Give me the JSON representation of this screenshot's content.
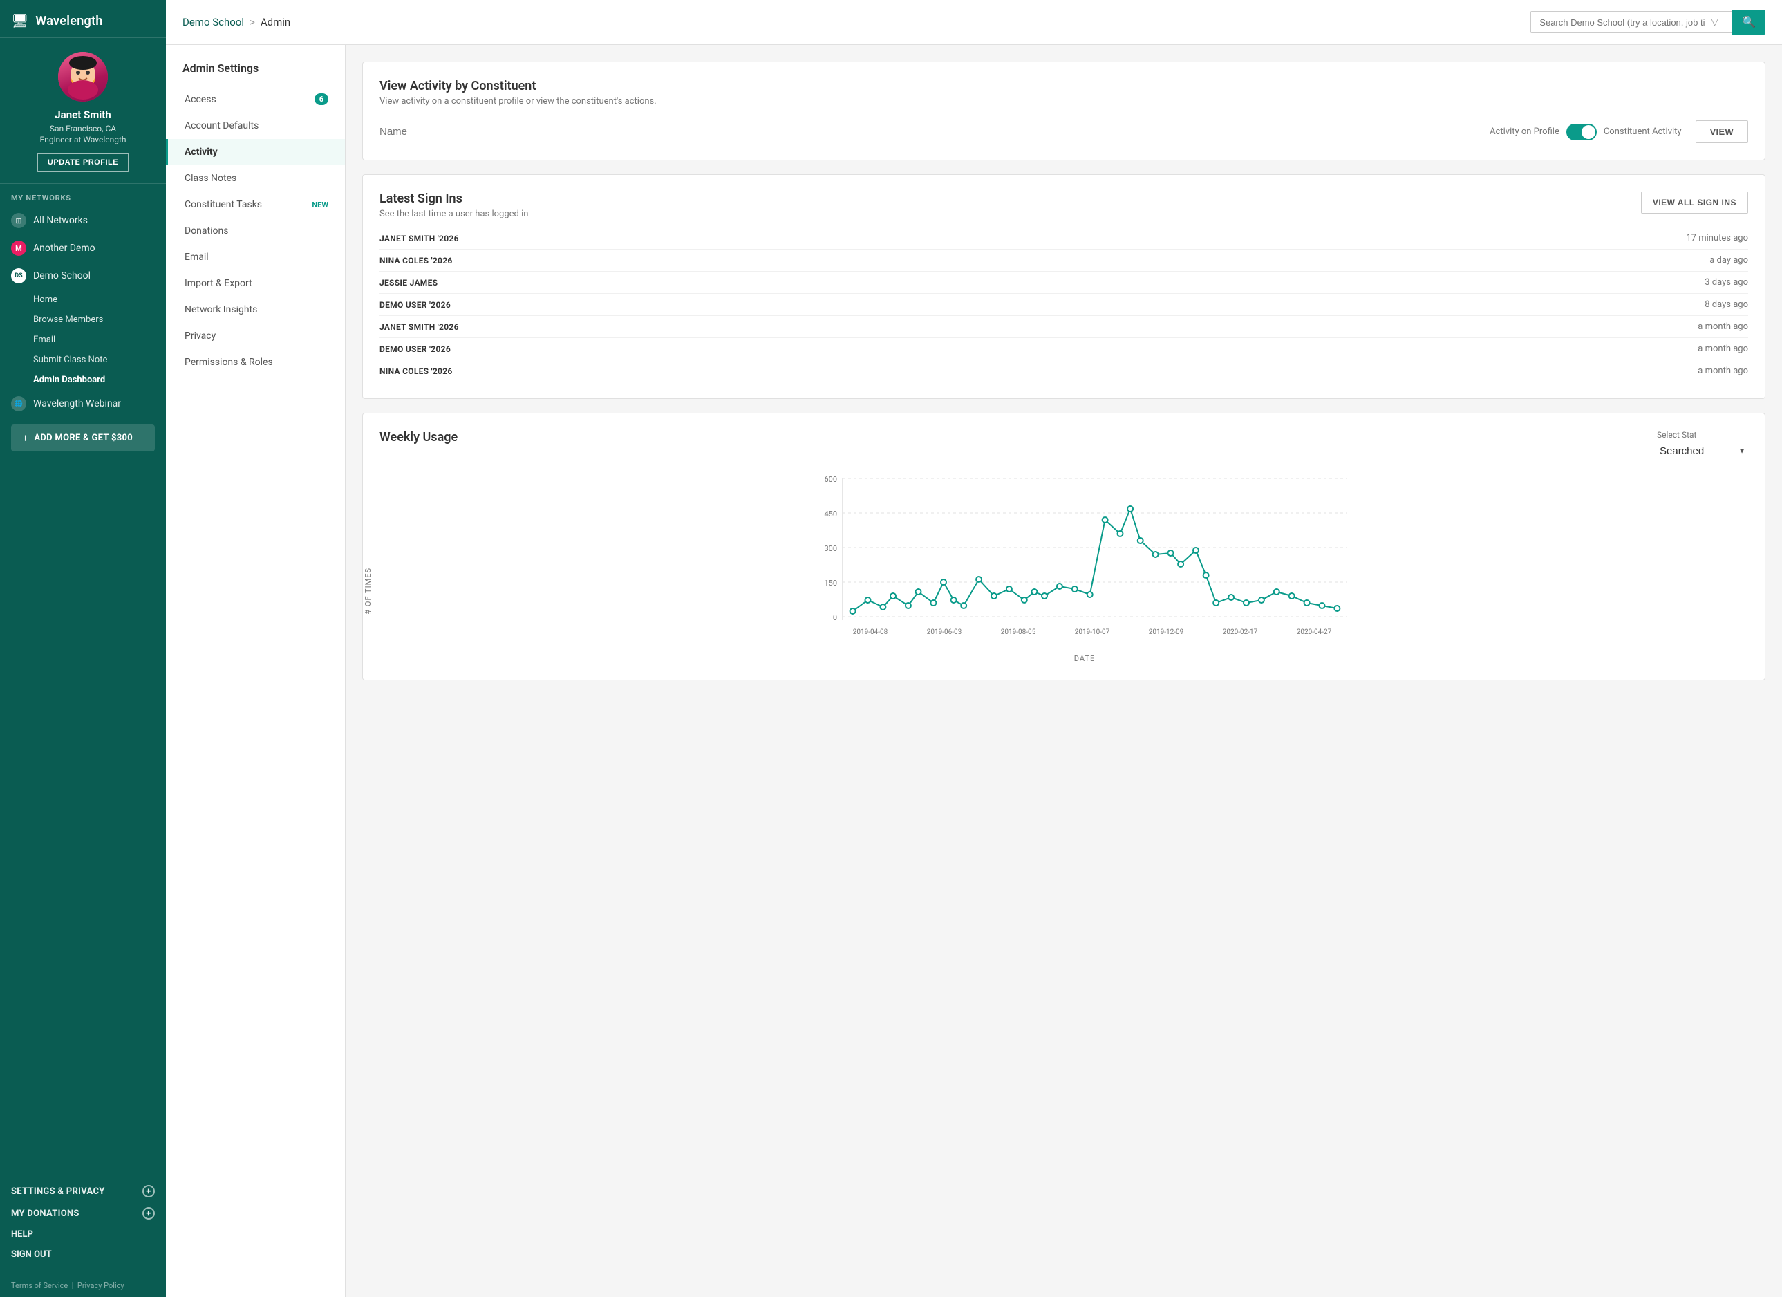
{
  "sidebar": {
    "logo": "🖥 Wavelength",
    "logo_text": "Wavelength",
    "user": {
      "name": "Janet Smith",
      "location": "San Francisco, CA",
      "title": "Engineer at Wavelength",
      "update_btn": "UPDATE PROFILE"
    },
    "my_networks_label": "MY NETWORKS",
    "networks": [
      {
        "id": "all",
        "label": "All Networks",
        "icon": "grid"
      },
      {
        "id": "another-demo",
        "label": "Another Demo",
        "icon": "M"
      },
      {
        "id": "demo-school",
        "label": "Demo School",
        "icon": "DS",
        "active": true
      }
    ],
    "demo_school_subnav": [
      {
        "id": "home",
        "label": "Home",
        "active": false
      },
      {
        "id": "browse-members",
        "label": "Browse Members",
        "active": false
      },
      {
        "id": "email",
        "label": "Email",
        "active": false
      },
      {
        "id": "submit-class-note",
        "label": "Submit Class Note",
        "active": false
      },
      {
        "id": "admin-dashboard",
        "label": "Admin Dashboard",
        "active": true
      }
    ],
    "wavelength_webinar": {
      "label": "Wavelength Webinar",
      "icon": "WW"
    },
    "add_more": "ADD MORE & GET $300",
    "settings_privacy": "SETTINGS & PRIVACY",
    "my_donations": "MY DONATIONS",
    "help": "HELP",
    "sign_out": "SIGN OUT",
    "footer": {
      "terms": "Terms of Service",
      "privacy": "Privacy Policy"
    }
  },
  "topbar": {
    "breadcrumb": {
      "school": "Demo School",
      "separator": ">",
      "page": "Admin"
    },
    "search_placeholder": "Search Demo School (try a location, job title, or c..."
  },
  "admin_settings": {
    "title": "Admin Settings",
    "items": [
      {
        "id": "access",
        "label": "Access",
        "badge": "6",
        "badge_type": "count"
      },
      {
        "id": "account-defaults",
        "label": "Account Defaults",
        "badge": null
      },
      {
        "id": "activity",
        "label": "Activity",
        "badge": null,
        "active": true
      },
      {
        "id": "class-notes",
        "label": "Class Notes",
        "badge": null
      },
      {
        "id": "constituent-tasks",
        "label": "Constituent Tasks",
        "badge": "NEW",
        "badge_type": "new"
      },
      {
        "id": "donations",
        "label": "Donations",
        "badge": null
      },
      {
        "id": "email",
        "label": "Email",
        "badge": null
      },
      {
        "id": "import-export",
        "label": "Import & Export",
        "badge": null
      },
      {
        "id": "network-insights",
        "label": "Network Insights",
        "badge": null
      },
      {
        "id": "privacy",
        "label": "Privacy",
        "badge": null
      },
      {
        "id": "permissions-roles",
        "label": "Permissions & Roles",
        "badge": null
      }
    ]
  },
  "view_activity": {
    "title": "View Activity by Constituent",
    "subtitle": "View activity on a constituent profile or view the constituent's actions.",
    "name_placeholder": "Name",
    "toggle_left": "Activity on Profile",
    "toggle_right": "Constituent Activity",
    "view_btn": "VIEW"
  },
  "latest_sign_ins": {
    "title": "Latest Sign Ins",
    "subtitle": "See the last time a user has logged in",
    "view_all_btn": "VIEW ALL SIGN INS",
    "entries": [
      {
        "name": "JANET SMITH '2026",
        "time": "17 minutes ago"
      },
      {
        "name": "NINA COLES '2026",
        "time": "a day ago"
      },
      {
        "name": "JESSIE JAMES",
        "time": "3 days ago"
      },
      {
        "name": "DEMO USER '2026",
        "time": "8 days ago"
      },
      {
        "name": "JANET SMITH '2026",
        "time": "a month ago"
      },
      {
        "name": "DEMO USER '2026",
        "time": "a month ago"
      },
      {
        "name": "NINA COLES '2026",
        "time": "a month ago"
      }
    ]
  },
  "weekly_usage": {
    "title": "Weekly Usage",
    "select_stat_label": "Select Stat",
    "selected_stat": "Searched",
    "y_axis_label": "# OF TIMES",
    "x_axis_label": "DATE",
    "x_labels": [
      "2019-04-08",
      "2019-06-03",
      "2019-08-05",
      "2019-10-07",
      "2019-12-09",
      "2020-02-17",
      "2020-04-27"
    ],
    "y_labels": [
      "0",
      "150",
      "300",
      "450",
      "600"
    ],
    "chart_color": "#0a9b8a",
    "data_points": [
      {
        "x": 0.02,
        "y": 0.04
      },
      {
        "x": 0.05,
        "y": 0.12
      },
      {
        "x": 0.08,
        "y": 0.07
      },
      {
        "x": 0.1,
        "y": 0.15
      },
      {
        "x": 0.13,
        "y": 0.08
      },
      {
        "x": 0.15,
        "y": 0.18
      },
      {
        "x": 0.18,
        "y": 0.1
      },
      {
        "x": 0.2,
        "y": 0.25
      },
      {
        "x": 0.22,
        "y": 0.12
      },
      {
        "x": 0.24,
        "y": 0.08
      },
      {
        "x": 0.27,
        "y": 0.27
      },
      {
        "x": 0.3,
        "y": 0.15
      },
      {
        "x": 0.33,
        "y": 0.2
      },
      {
        "x": 0.36,
        "y": 0.12
      },
      {
        "x": 0.38,
        "y": 0.18
      },
      {
        "x": 0.4,
        "y": 0.15
      },
      {
        "x": 0.43,
        "y": 0.22
      },
      {
        "x": 0.46,
        "y": 0.2
      },
      {
        "x": 0.49,
        "y": 0.16
      },
      {
        "x": 0.52,
        "y": 0.7
      },
      {
        "x": 0.55,
        "y": 0.6
      },
      {
        "x": 0.57,
        "y": 0.78
      },
      {
        "x": 0.59,
        "y": 0.55
      },
      {
        "x": 0.62,
        "y": 0.45
      },
      {
        "x": 0.65,
        "y": 0.46
      },
      {
        "x": 0.67,
        "y": 0.38
      },
      {
        "x": 0.7,
        "y": 0.48
      },
      {
        "x": 0.72,
        "y": 0.3
      },
      {
        "x": 0.74,
        "y": 0.1
      },
      {
        "x": 0.77,
        "y": 0.14
      },
      {
        "x": 0.8,
        "y": 0.1
      },
      {
        "x": 0.83,
        "y": 0.12
      },
      {
        "x": 0.86,
        "y": 0.18
      },
      {
        "x": 0.89,
        "y": 0.15
      },
      {
        "x": 0.92,
        "y": 0.1
      },
      {
        "x": 0.95,
        "y": 0.08
      },
      {
        "x": 0.98,
        "y": 0.06
      }
    ]
  }
}
